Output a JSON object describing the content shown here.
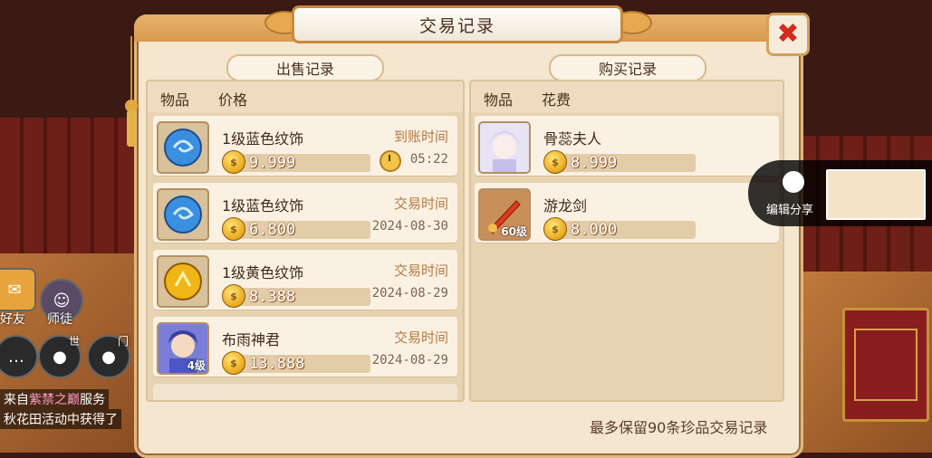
{
  "window": {
    "title": "交易记录",
    "close_icon": "close-icon",
    "footer_note": "最多保留90条珍品交易记录"
  },
  "sales": {
    "tab_label": "出售记录",
    "header_item": "物品",
    "header_price": "价格",
    "rows": [
      {
        "name": "1级蓝色纹饰",
        "price": "9.999",
        "time_label": "到账时间",
        "time_value": "05:22",
        "icon": "blue-pattern-orb"
      },
      {
        "name": "1级蓝色纹饰",
        "price": "6.800",
        "time_label": "交易时间",
        "time_value": "2024-08-30",
        "icon": "blue-pattern-orb"
      },
      {
        "name": "1级黄色纹饰",
        "price": "8.388",
        "time_label": "交易时间",
        "time_value": "2024-08-29",
        "icon": "yellow-pattern-orb"
      },
      {
        "name": "布雨神君",
        "price": "13.888",
        "time_label": "交易时间",
        "time_value": "2024-08-29",
        "icon": "character-portrait",
        "level": "4级"
      }
    ]
  },
  "purchases": {
    "tab_label": "购买记录",
    "header_item": "物品",
    "header_cost": "花费",
    "rows": [
      {
        "name": "骨蕊夫人",
        "price": "8.999",
        "icon": "character-portrait"
      },
      {
        "name": "游龙剑",
        "price": "8.000",
        "icon": "sword",
        "level": "60级"
      }
    ]
  },
  "share": {
    "label": "编辑分享"
  },
  "background": {
    "friends_label": "好友",
    "mentor_label": "师徒",
    "chat_line_1_prefix": "来自",
    "chat_line_1_highlight": "紫禁之巅",
    "chat_line_1_suffix": "服务",
    "chat_line_2": "秋花田活动中获得了",
    "voice_label_1": "世",
    "voice_label_2": "门"
  },
  "colors": {
    "accent": "#d89a50",
    "close": "#d32b1e",
    "panel": "#f4e6cf"
  }
}
